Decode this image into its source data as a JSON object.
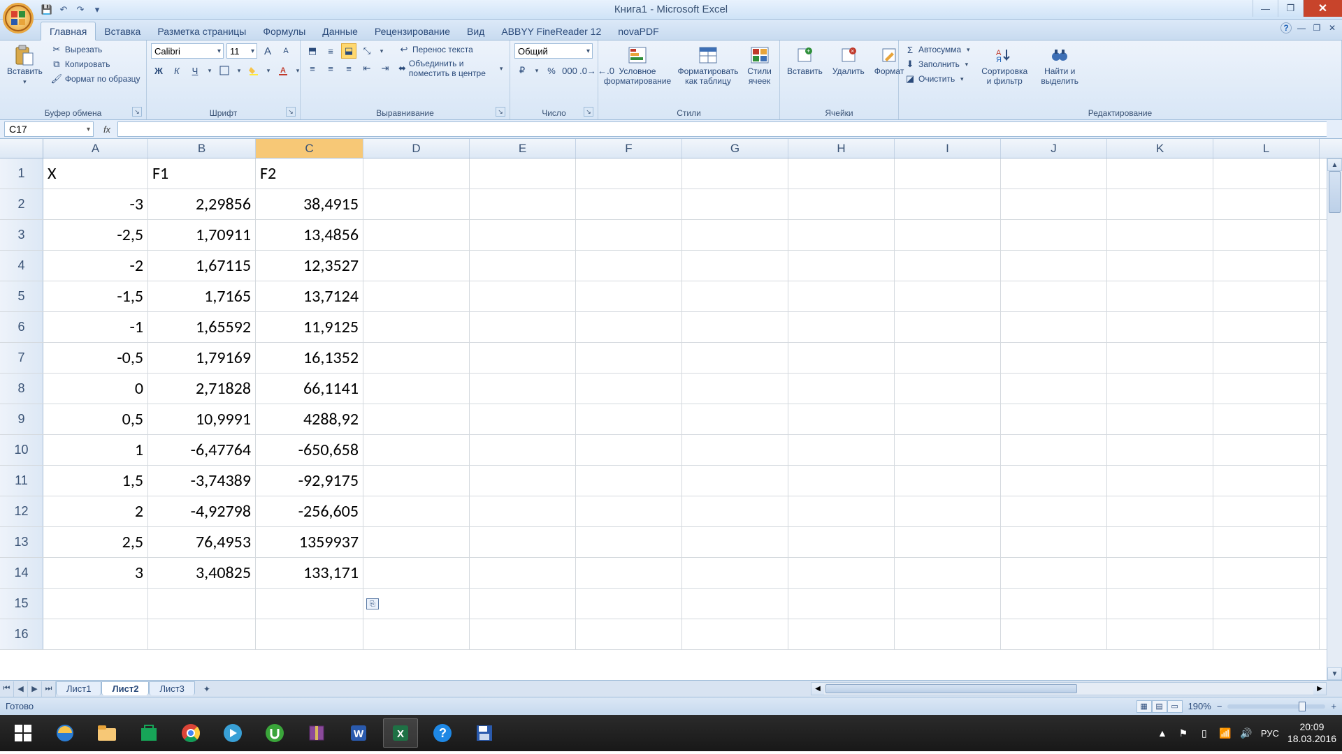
{
  "app": {
    "title": "Книга1 - Microsoft Excel"
  },
  "qat": {
    "save": "💾",
    "undo": "↶",
    "redo": "↷",
    "custom": "▾"
  },
  "win": {
    "min": "—",
    "max": "❐",
    "close": "✕"
  },
  "tabs": {
    "home": "Главная",
    "insert": "Вставка",
    "layout": "Разметка страницы",
    "formulas": "Формулы",
    "data": "Данные",
    "review": "Рецензирование",
    "view": "Вид",
    "abbyy": "ABBYY FineReader 12",
    "nova": "novaPDF"
  },
  "help_icons": {
    "help": "?",
    "min": "—",
    "rest": "❐",
    "close": "✕"
  },
  "ribbon": {
    "clipboard": {
      "paste": "Вставить",
      "cut": "Вырезать",
      "copy": "Копировать",
      "format_painter": "Формат по образцу",
      "label": "Буфер обмена"
    },
    "font": {
      "name": "Calibri",
      "size": "11",
      "grow": "A",
      "shrink": "A",
      "bold": "Ж",
      "italic": "К",
      "underline": "Ч",
      "label": "Шрифт"
    },
    "align": {
      "wrap": "Перенос текста",
      "merge": "Объединить и поместить в центре",
      "label": "Выравнивание"
    },
    "number": {
      "format": "Общий",
      "label": "Число"
    },
    "styles": {
      "cond": "Условное форматирование",
      "table": "Форматировать как таблицу",
      "cell": "Стили ячеек",
      "label": "Стили"
    },
    "cells": {
      "insert": "Вставить",
      "delete": "Удалить",
      "format": "Формат",
      "label": "Ячейки"
    },
    "editing": {
      "autosum": "Автосумма",
      "fill": "Заполнить",
      "clear": "Очистить",
      "sort": "Сортировка и фильтр",
      "find": "Найти и выделить",
      "label": "Редактирование"
    }
  },
  "namebox": "C17",
  "columns": [
    "A",
    "B",
    "C",
    "D",
    "E",
    "F",
    "G",
    "H",
    "I",
    "J",
    "K",
    "L"
  ],
  "col_widths": {
    "A": 150,
    "B": 154,
    "C": 154
  },
  "selected_col": "C",
  "headers": {
    "A": "X",
    "B": "F1",
    "C": "F2"
  },
  "data_rows": [
    {
      "r": 2,
      "A": "-3",
      "B": "2,29856",
      "C": "38,4915"
    },
    {
      "r": 3,
      "A": "-2,5",
      "B": "1,70911",
      "C": "13,4856"
    },
    {
      "r": 4,
      "A": "-2",
      "B": "1,67115",
      "C": "12,3527"
    },
    {
      "r": 5,
      "A": "-1,5",
      "B": "1,7165",
      "C": "13,7124"
    },
    {
      "r": 6,
      "A": "-1",
      "B": "1,65592",
      "C": "11,9125"
    },
    {
      "r": 7,
      "A": "-0,5",
      "B": "1,79169",
      "C": "16,1352"
    },
    {
      "r": 8,
      "A": "0",
      "B": "2,71828",
      "C": "66,1141"
    },
    {
      "r": 9,
      "A": "0,5",
      "B": "10,9991",
      "C": "4288,92"
    },
    {
      "r": 10,
      "A": "1",
      "B": "-6,47764",
      "C": "-650,658"
    },
    {
      "r": 11,
      "A": "1,5",
      "B": "-3,74389",
      "C": "-92,9175"
    },
    {
      "r": 12,
      "A": "2",
      "B": "-4,92798",
      "C": "-256,605"
    },
    {
      "r": 13,
      "A": "2,5",
      "B": "76,4953",
      "C": "1359937"
    },
    {
      "r": 14,
      "A": "3",
      "B": "3,40825",
      "C": "133,171"
    }
  ],
  "empty_rows": [
    15,
    16
  ],
  "sheets": {
    "s1": "Лист1",
    "s2": "Лист2",
    "s3": "Лист3",
    "active": "s2"
  },
  "status": {
    "ready": "Готово",
    "zoom": "190%"
  },
  "zoom_thumb_pct": 78,
  "tray": {
    "lang": "РУС",
    "time": "20:09",
    "date": "18.03.2016",
    "up": "▲"
  },
  "chart_data": {
    "type": "table",
    "title": "",
    "columns": [
      "X",
      "F1",
      "F2"
    ],
    "rows": [
      [
        -3,
        2.29856,
        38.4915
      ],
      [
        -2.5,
        1.70911,
        13.4856
      ],
      [
        -2,
        1.67115,
        12.3527
      ],
      [
        -1.5,
        1.7165,
        13.7124
      ],
      [
        -1,
        1.65592,
        11.9125
      ],
      [
        -0.5,
        1.79169,
        16.1352
      ],
      [
        0,
        2.71828,
        66.1141
      ],
      [
        0.5,
        10.9991,
        4288.92
      ],
      [
        1,
        -6.47764,
        -650.658
      ],
      [
        1.5,
        -3.74389,
        -92.9175
      ],
      [
        2,
        -4.92798,
        -256.605
      ],
      [
        2.5,
        76.4953,
        1359937
      ],
      [
        3,
        3.40825,
        133.171
      ]
    ]
  }
}
